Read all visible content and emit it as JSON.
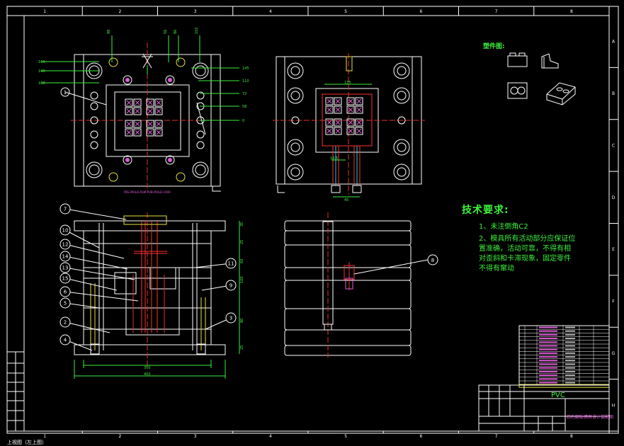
{
  "drawing": {
    "border_letters": [
      "A",
      "B",
      "C",
      "D",
      "E",
      "F",
      "G",
      "H"
    ],
    "border_numbers": [
      "1",
      "2",
      "3",
      "4",
      "5",
      "6",
      "7",
      "8"
    ],
    "colors": {
      "border": "#ffffff",
      "outline": "#ffffff",
      "centerline": "#e03030",
      "dimension": "#3cf03c",
      "cooling": "#ff3030",
      "magenta": "#e05bd8",
      "yellow": "#e8e040",
      "cyan": "#20c8e0"
    }
  },
  "top_view": {
    "left_dims": [
      "160",
      "140",
      "108"
    ],
    "right_dims": [
      "145",
      "110",
      "72",
      "58",
      "0"
    ],
    "top_dims": [
      "98",
      "56",
      "86",
      "102"
    ],
    "callout": "1",
    "caption": "PRE-MOLD-ASM-PUB-MOLD-1000"
  },
  "right_top_view": {
    "dim_top": "135",
    "dim_bottom": "45",
    "dim_left": "18.5"
  },
  "front_section": {
    "callouts_left": [
      "7",
      "10",
      "12",
      "14",
      "13",
      "15",
      "6",
      "5",
      "2",
      "4"
    ],
    "callouts_right": [
      "11",
      "9",
      "3"
    ],
    "bottom_dims": [
      "350",
      "400"
    ],
    "right_dims": [
      "35",
      "25",
      "60",
      "100",
      "80",
      "25"
    ]
  },
  "side_section": {
    "callout": "8"
  },
  "parts": {
    "label": "塑件图:"
  },
  "tech": {
    "title": "技术要求:",
    "lines": [
      "1、未注倒角C2",
      "2、模具所有活动部分应保证位",
      "置准确，活动可靠，不得有相",
      "对歪斜和卡滞现象，固定零件",
      "不得有窜动"
    ]
  },
  "title_block": {
    "material": "PVC",
    "drawing_name": "四孔翻板模具设计装配图"
  },
  "status_bar": "上视图（左上图）"
}
